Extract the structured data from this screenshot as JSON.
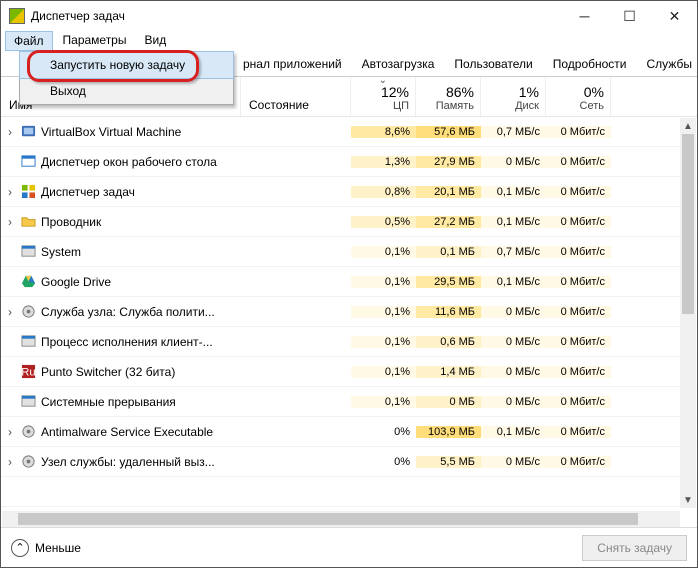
{
  "window": {
    "title": "Диспетчер задач"
  },
  "menubar": {
    "file": "Файл",
    "options": "Параметры",
    "view": "Вид"
  },
  "dropdown": {
    "run": "Запустить новую задачу",
    "exit": "Выход"
  },
  "tabs": {
    "history": "рнал приложений",
    "startup": "Автозагрузка",
    "users": "Пользователи",
    "details": "Подробности",
    "services": "Службы"
  },
  "columns": {
    "name": "Имя",
    "state": "Состояние",
    "cpu_pct": "12%",
    "cpu_lbl": "ЦП",
    "mem_pct": "86%",
    "mem_lbl": "Память",
    "disk_pct": "1%",
    "disk_lbl": "Диск",
    "net_pct": "0%",
    "net_lbl": "Сеть"
  },
  "rows": [
    {
      "exp": "›",
      "name": "VirtualBox Virtual Machine",
      "cpu": "8,6%",
      "mem": "57,6 МБ",
      "disk": "0,7 МБ/с",
      "net": "0 Мбит/с",
      "c": "bg2",
      "m": "bg3",
      "icon": "vbox"
    },
    {
      "exp": "",
      "name": "Диспетчер окон рабочего стола",
      "cpu": "1,3%",
      "mem": "27,9 МБ",
      "disk": "0 МБ/с",
      "net": "0 Мбит/с",
      "c": "bg1",
      "m": "bg2",
      "icon": "dwm"
    },
    {
      "exp": "›",
      "name": "Диспетчер задач",
      "cpu": "0,8%",
      "mem": "20,1 МБ",
      "disk": "0,1 МБ/с",
      "net": "0 Мбит/с",
      "c": "bg1",
      "m": "bg2",
      "icon": "tm"
    },
    {
      "exp": "›",
      "name": "Проводник",
      "cpu": "0,5%",
      "mem": "27,2 МБ",
      "disk": "0,1 МБ/с",
      "net": "0 Мбит/с",
      "c": "bg1",
      "m": "bg2",
      "icon": "folder"
    },
    {
      "exp": "",
      "name": "System",
      "cpu": "0,1%",
      "mem": "0,1 МБ",
      "disk": "0,7 МБ/с",
      "net": "0 Мбит/с",
      "c": "bg4",
      "m": "bg1",
      "icon": "sys"
    },
    {
      "exp": "",
      "name": "Google Drive",
      "cpu": "0,1%",
      "mem": "29,5 МБ",
      "disk": "0,1 МБ/с",
      "net": "0 Мбит/с",
      "c": "bg4",
      "m": "bg2",
      "icon": "gdrive"
    },
    {
      "exp": "›",
      "name": "Служба узла: Служба полити...",
      "cpu": "0,1%",
      "mem": "11,6 МБ",
      "disk": "0 МБ/с",
      "net": "0 Мбит/с",
      "c": "bg4",
      "m": "bg2",
      "icon": "svc"
    },
    {
      "exp": "",
      "name": "Процесс исполнения клиент-...",
      "cpu": "0,1%",
      "mem": "0,6 МБ",
      "disk": "0 МБ/с",
      "net": "0 Мбит/с",
      "c": "bg4",
      "m": "bg1",
      "icon": "sys"
    },
    {
      "exp": "",
      "name": "Punto Switcher (32 бита)",
      "cpu": "0,1%",
      "mem": "1,4 МБ",
      "disk": "0 МБ/с",
      "net": "0 Мбит/с",
      "c": "bg4",
      "m": "bg1",
      "icon": "punto"
    },
    {
      "exp": "",
      "name": "Системные прерывания",
      "cpu": "0,1%",
      "mem": "0 МБ",
      "disk": "0 МБ/с",
      "net": "0 Мбит/с",
      "c": "bg4",
      "m": "bg1",
      "icon": "sys"
    },
    {
      "exp": "›",
      "name": "Antimalware Service Executable",
      "cpu": "0%",
      "mem": "103,9 МБ",
      "disk": "0,1 МБ/с",
      "net": "0 Мбит/с",
      "c": "",
      "m": "bg3",
      "icon": "svc"
    },
    {
      "exp": "›",
      "name": "Узел службы: удаленный выз...",
      "cpu": "0%",
      "mem": "5,5 МБ",
      "disk": "0 МБ/с",
      "net": "0 Мбит/с",
      "c": "",
      "m": "bg1",
      "icon": "svc"
    },
    {
      "exp": "",
      "name": "",
      "cpu": "",
      "mem": "",
      "disk": "",
      "net": "",
      "c": "",
      "m": "",
      "icon": ""
    }
  ],
  "footer": {
    "less": "Меньше",
    "end_task": "Снять задачу"
  }
}
